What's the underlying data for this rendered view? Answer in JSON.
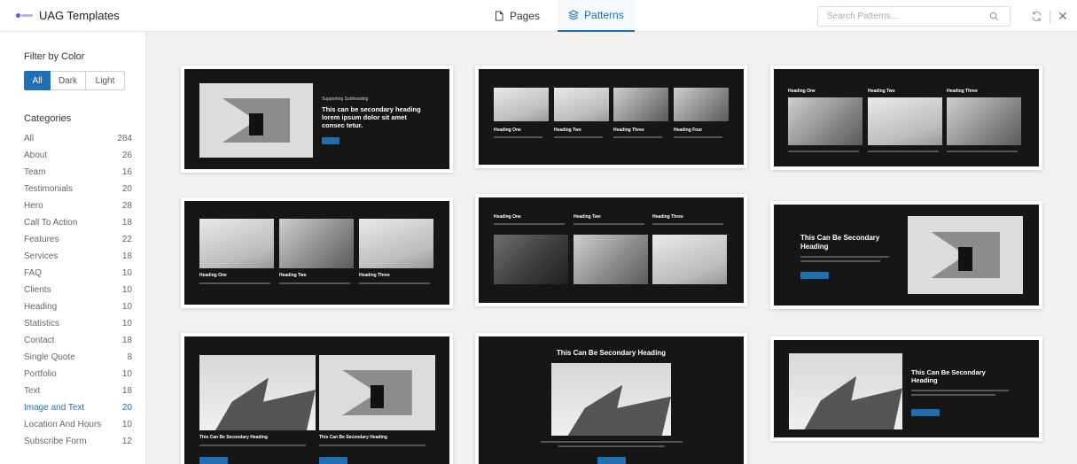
{
  "header": {
    "app_title": "UAG Templates",
    "tabs": [
      {
        "label": "Pages",
        "icon": "page-icon",
        "active": false
      },
      {
        "label": "Patterns",
        "icon": "layers-icon",
        "active": true
      }
    ],
    "search_placeholder": "Search Patterns...",
    "accent_color": "#1f6fb2"
  },
  "sidebar": {
    "filter_title": "Filter by Color",
    "color_options": [
      {
        "label": "All",
        "active": true
      },
      {
        "label": "Dark",
        "active": false
      },
      {
        "label": "Light",
        "active": false
      }
    ],
    "categories_title": "Categories",
    "categories": [
      {
        "label": "All",
        "count": "284"
      },
      {
        "label": "About",
        "count": "26"
      },
      {
        "label": "Team",
        "count": "16"
      },
      {
        "label": "Testimonials",
        "count": "20"
      },
      {
        "label": "Hero",
        "count": "28"
      },
      {
        "label": "Call To Action",
        "count": "18"
      },
      {
        "label": "Features",
        "count": "22"
      },
      {
        "label": "Services",
        "count": "18"
      },
      {
        "label": "FAQ",
        "count": "10"
      },
      {
        "label": "Clients",
        "count": "10"
      },
      {
        "label": "Heading",
        "count": "10"
      },
      {
        "label": "Statistics",
        "count": "10"
      },
      {
        "label": "Contact",
        "count": "18"
      },
      {
        "label": "Single Quote",
        "count": "8"
      },
      {
        "label": "Portfolio",
        "count": "10"
      },
      {
        "label": "Text",
        "count": "18"
      },
      {
        "label": "Image and Text",
        "count": "20",
        "active": true
      },
      {
        "label": "Location And Hours",
        "count": "10"
      },
      {
        "label": "Subscribe Form",
        "count": "12"
      }
    ]
  },
  "patterns": {
    "card1": {
      "sub": "Supporting Subheading",
      "heading": "This can be secondary heading lorem ipsum dolor sit amet consec tetur."
    },
    "card2": {
      "headings": [
        "Heading One",
        "Heading Two",
        "Heading Three",
        "Heading Four"
      ]
    },
    "card3": {
      "headings": [
        "Heading One",
        "Heading Two",
        "Heading Three"
      ]
    },
    "card4": {
      "headings": [
        "Heading One",
        "Heading Two",
        "Heading Three"
      ]
    },
    "card5": {
      "headings": [
        "Heading One",
        "Heading Two",
        "Heading Three"
      ]
    },
    "card6": {
      "heading": "This Can Be Secondary Heading"
    },
    "card7": {
      "headings": [
        "This Can Be Secondary Heading",
        "This Can Be Secondary Heading"
      ]
    },
    "card8": {
      "heading": "This Can Be Secondary Heading"
    },
    "card9": {
      "heading": "This Can Be Secondary Heading"
    }
  }
}
